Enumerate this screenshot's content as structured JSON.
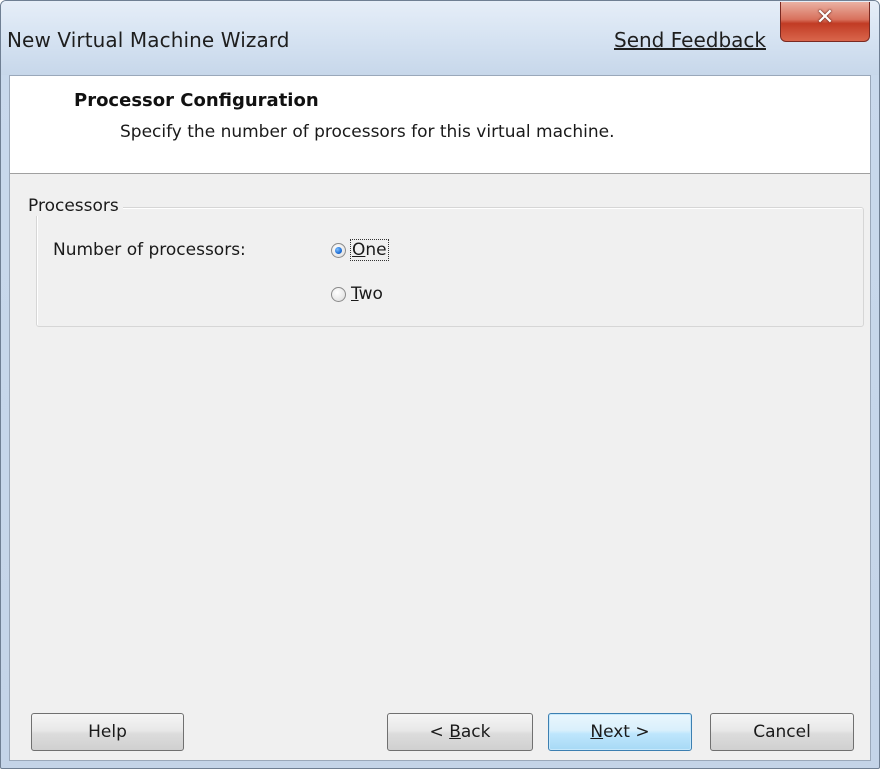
{
  "window": {
    "title": "New Virtual Machine Wizard",
    "feedback_link": "Send Feedback",
    "close_glyph": "✕",
    "close_icon": "close-icon"
  },
  "header": {
    "title": "Processor Configuration",
    "subtitle": "Specify the number of processors for this virtual machine."
  },
  "processors": {
    "group_label": "Processors",
    "field_label": "Number of processors:",
    "options": [
      {
        "mnemonic": "O",
        "rest": "ne",
        "checked": true
      },
      {
        "mnemonic": "T",
        "rest": "wo",
        "checked": false
      }
    ]
  },
  "buttons": {
    "help": "Help",
    "back_prefix": "< ",
    "back_mnemonic": "B",
    "back_rest": "ack",
    "next_mnemonic": "N",
    "next_rest": "ext >",
    "cancel": "Cancel"
  },
  "colors": {
    "title_bar": "#d6e3f2",
    "close_button": "#c13b24",
    "default_button_border": "#3c7fb1",
    "radio_dot": "#1f6fd6"
  }
}
